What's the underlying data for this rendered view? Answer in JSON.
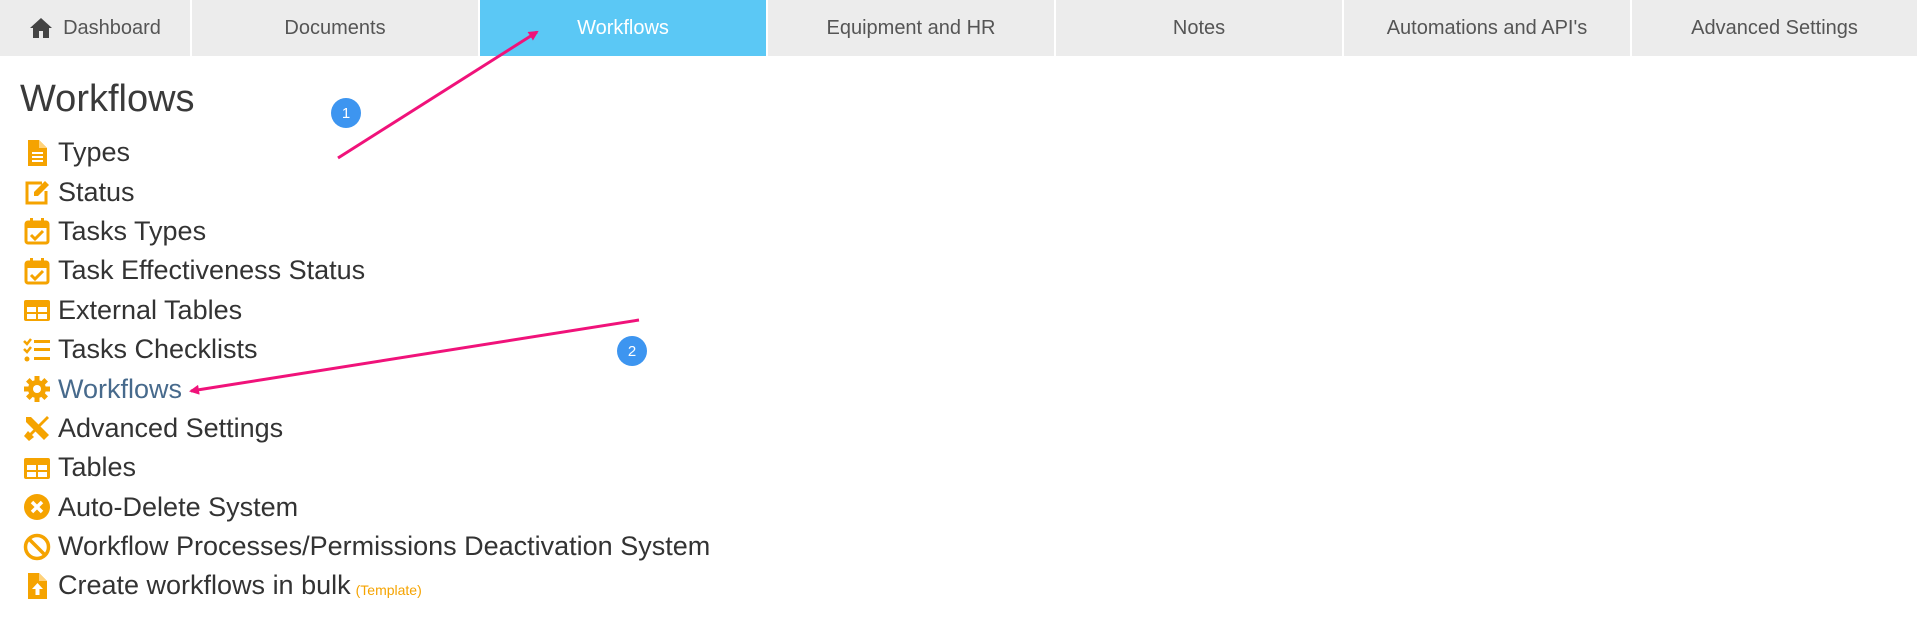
{
  "nav": {
    "tabs": [
      {
        "label": "Dashboard",
        "icon": "home-icon"
      },
      {
        "label": "Documents"
      },
      {
        "label": "Workflows",
        "active": true
      },
      {
        "label": "Equipment and HR"
      },
      {
        "label": "Notes"
      },
      {
        "label": "Automations and API's"
      },
      {
        "label": "Advanced Settings"
      }
    ]
  },
  "page": {
    "title": "Workflows",
    "menu": [
      {
        "label": "Types",
        "icon": "file-text-icon"
      },
      {
        "label": "Status",
        "icon": "edit-icon"
      },
      {
        "label": "Tasks Types",
        "icon": "calendar-check-icon"
      },
      {
        "label": "Task Effectiveness Status",
        "icon": "calendar-check-icon"
      },
      {
        "label": "External Tables",
        "icon": "table-icon"
      },
      {
        "label": "Tasks Checklists",
        "icon": "list-check-icon"
      },
      {
        "label": "Workflows",
        "icon": "gear-icon",
        "current": true
      },
      {
        "label": "Advanced Settings",
        "icon": "tools-icon"
      },
      {
        "label": "Tables",
        "icon": "table-icon"
      },
      {
        "label": "Auto-Delete System",
        "icon": "times-circle-icon"
      },
      {
        "label": "Workflow Processes/Permissions Deactivation System",
        "icon": "ban-icon"
      },
      {
        "label": "Create workflows in bulk",
        "icon": "file-upload-icon",
        "note": "(Template)"
      }
    ]
  },
  "annotations": {
    "step1": "1",
    "step2": "2"
  },
  "colors": {
    "active_tab": "#5bc8f5",
    "icon_orange": "#f5a300",
    "arrow": "#f0127a",
    "badge": "#3d95f0",
    "current_link": "#476a8c"
  }
}
